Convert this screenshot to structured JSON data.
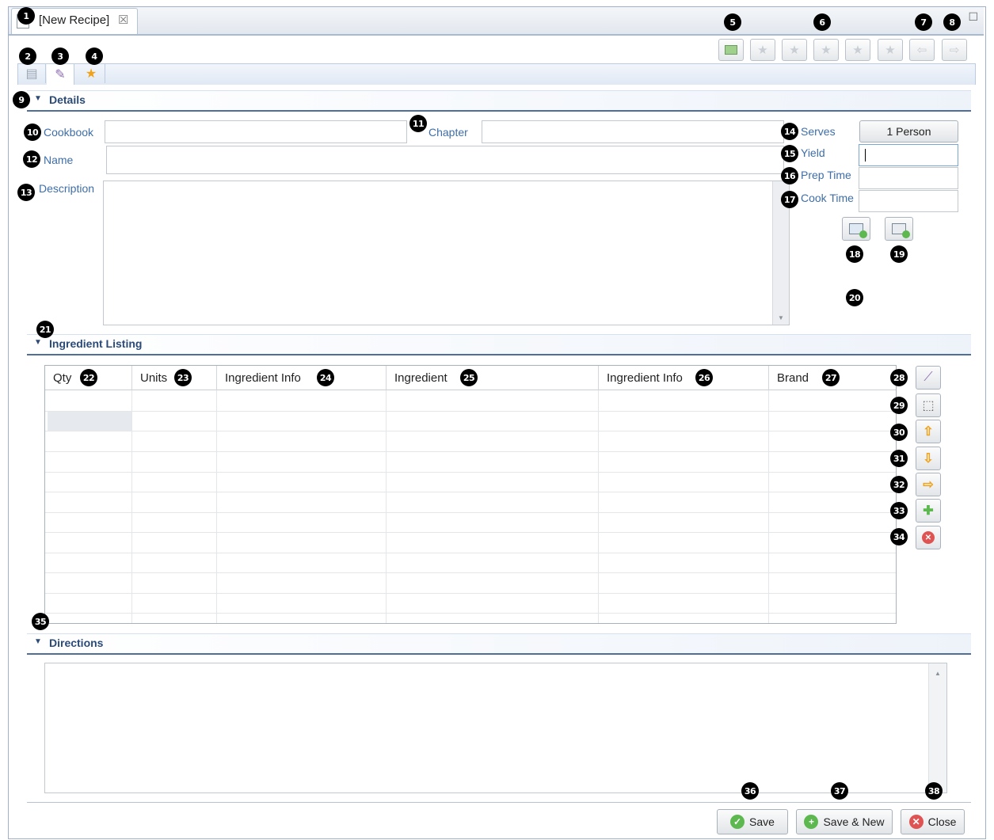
{
  "tab": {
    "title": "[New Recipe]",
    "close": "☒"
  },
  "toolbar": {
    "export_icon": "export-icon",
    "star_icon": "★",
    "back": "⇦",
    "forward": "⇨",
    "maximize": "☐"
  },
  "subtabs": {
    "overview": "▤",
    "edit": "✎",
    "favorite": "★"
  },
  "details": {
    "header": "Details",
    "cookbook_label": "Cookbook",
    "chapter_label": "Chapter",
    "name_label": "Name",
    "description_label": "Description",
    "serves_label": "Serves",
    "serves_value": "1 Person",
    "yield_label": "Yield",
    "prep_label": "Prep Time",
    "cook_label": "Cook Time"
  },
  "ingredients": {
    "header": "Ingredient Listing",
    "columns": [
      "Qty",
      "Units",
      "Ingredient Info",
      "Ingredient",
      "Ingredient Info",
      "Brand"
    ]
  },
  "directions": {
    "header": "Directions"
  },
  "footer": {
    "save": "Save",
    "save_new": "Save & New",
    "close": "Close"
  },
  "callouts": [
    "1",
    "2",
    "3",
    "4",
    "5",
    "6",
    "7",
    "8",
    "9",
    "10",
    "11",
    "12",
    "13",
    "14",
    "15",
    "16",
    "17",
    "18",
    "19",
    "20",
    "21",
    "22",
    "23",
    "24",
    "25",
    "26",
    "27",
    "28",
    "29",
    "30",
    "31",
    "32",
    "33",
    "34",
    "35",
    "36",
    "37",
    "38"
  ],
  "colors": {
    "label_blue": "#3e6ea8",
    "section_blue": "#2b4a78",
    "accent_orange": "#f0a21a",
    "save_green": "#5cb84f",
    "close_red": "#e05353"
  }
}
